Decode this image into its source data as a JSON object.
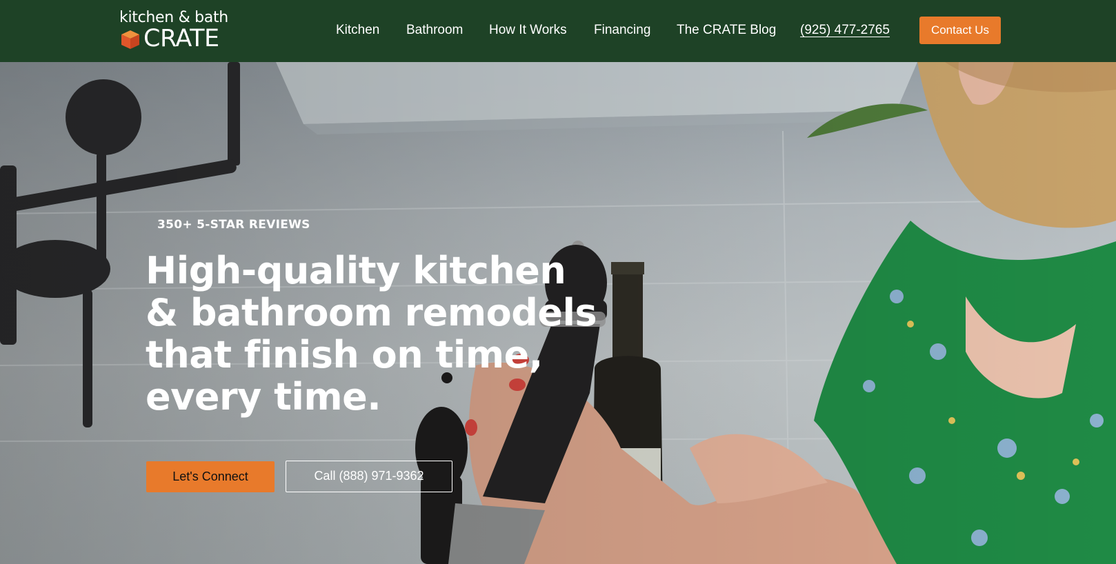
{
  "brand": {
    "logo_top": "kitchen & bath",
    "logo_word": "CRATE"
  },
  "nav": {
    "items": [
      {
        "label": "Kitchen"
      },
      {
        "label": "Bathroom"
      },
      {
        "label": "How It Works"
      },
      {
        "label": "Financing"
      },
      {
        "label": "The CRATE Blog"
      }
    ],
    "phone": "(925) 477-2765",
    "contact_label": "Contact Us"
  },
  "hero": {
    "eyebrow": "350+ 5-STAR REVIEWS",
    "headline_lines": [
      "High-quality kitchen",
      "& bathroom remodels",
      "that finish on time,",
      "every time."
    ],
    "primary_cta": "Let's Connect",
    "secondary_cta": "Call (888) 971-9362"
  },
  "colors": {
    "header_bg": "#1e4226",
    "accent": "#e87a2b",
    "text_light": "#ffffff"
  }
}
